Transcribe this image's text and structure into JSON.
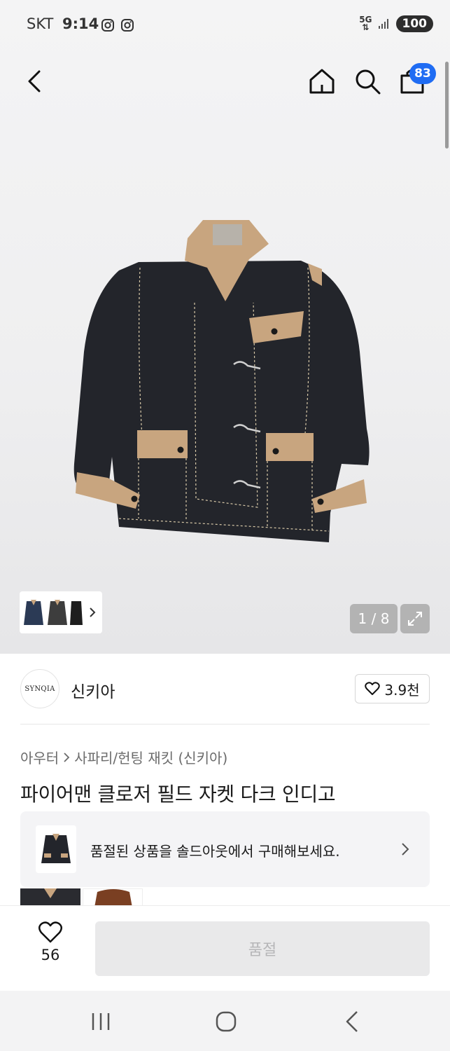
{
  "status_bar": {
    "carrier": "SKT",
    "time": "9:14",
    "network": "5G",
    "battery": "100"
  },
  "header": {
    "icons": [
      "back-arrow-icon",
      "home-icon",
      "search-icon",
      "shopping-bag-icon"
    ],
    "cart_count": "83"
  },
  "gallery": {
    "counter": "1 / 8",
    "image_icon": "denim-jacket-image",
    "colors": {
      "denim": "#23252b",
      "trim": "#c8a57f",
      "stitch": "#d8c9a8"
    }
  },
  "brand": {
    "logo_text": "SYNQIA",
    "name": "신키아",
    "likes": "3.9천"
  },
  "breadcrumb": {
    "category": "아우터",
    "subcategory": "사파리/헌팅 재킷 (신키아)"
  },
  "product": {
    "title": "파이어맨 클로저 필드 자켓 다크 인디고"
  },
  "soldout_banner": {
    "text": "품절된 상품을 솔드아웃에서 구매해보세요."
  },
  "purchase_bar": {
    "wish_count": "56",
    "buy_label": "품절",
    "accent_color": "#1f6cf3"
  }
}
